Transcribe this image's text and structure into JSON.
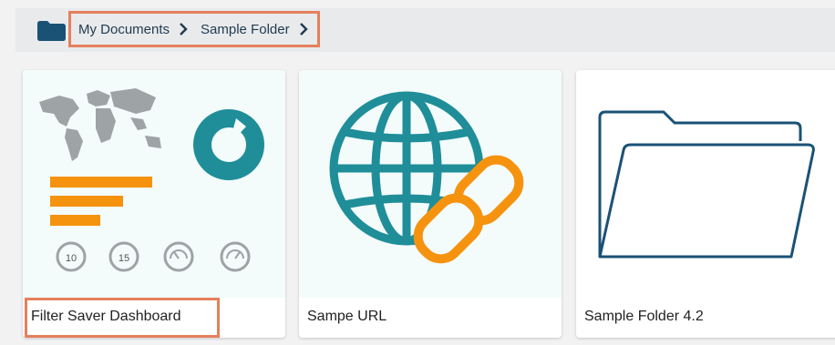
{
  "breadcrumb": {
    "items": [
      "My Documents",
      "Sample Folder"
    ],
    "icon": "folder-icon",
    "separator_icon": "chevron-right-icon"
  },
  "colors": {
    "accent_teal": "#1f8e99",
    "accent_orange": "#f5930f",
    "highlight_border": "#e5805d",
    "folder_dark": "#1a5276"
  },
  "cards": [
    {
      "title": "Filter Saver Dashboard",
      "icon": "dashboard-thumbnail",
      "gauges": [
        "10",
        "15"
      ]
    },
    {
      "title": "Sampe URL",
      "icon": "globe-link-icon"
    },
    {
      "title": "Sample Folder 4.2",
      "icon": "folder-outline-icon"
    }
  ]
}
